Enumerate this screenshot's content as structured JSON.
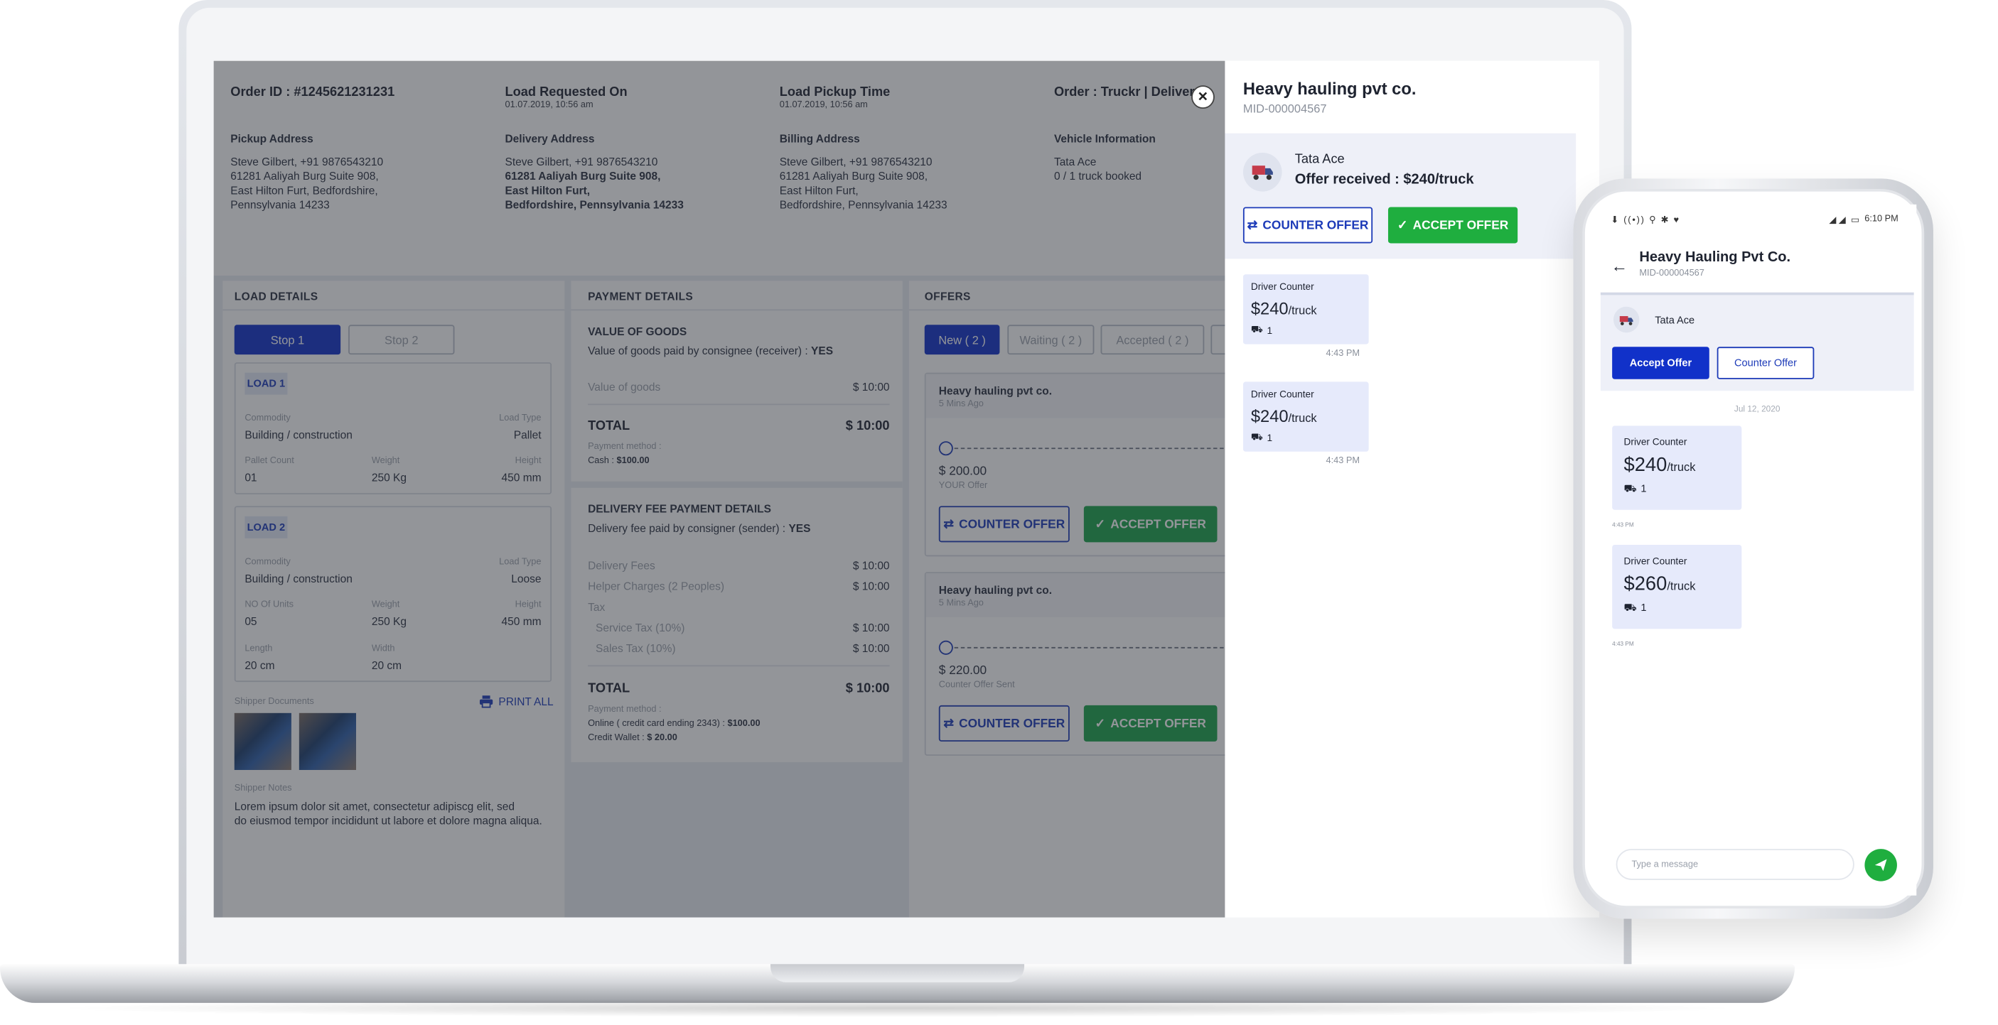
{
  "order": {
    "order_id": "Order ID : #1245621231231",
    "requested_label": "Load Requested On",
    "requested_value": "01.07.2019, 10:56 am",
    "pickup_time_label": "Load Pickup Time",
    "pickup_time_value": "01.07.2019, 10:56 am",
    "order_type": "Order : Truckr | Delivery",
    "pickup_address_label": "Pickup Address",
    "pickup_address": [
      "Steve Gilbert, +91 9876543210",
      "61281 Aaliyah Burg Suite 908,",
      "East Hilton Furt, Bedfordshire,",
      "Pennsylvania 14233"
    ],
    "delivery_address_label": "Delivery Address",
    "delivery_address": [
      "Steve Gilbert, +91 9876543210",
      "61281 Aaliyah Burg Suite 908,",
      "East Hilton Furt,",
      "Bedfordshire, Pennsylvania 14233"
    ],
    "billing_address_label": "Billing Address",
    "billing_address": [
      "Steve Gilbert, +91 9876543210",
      "61281 Aaliyah Burg Suite 908,",
      "East Hilton Furt,",
      "Bedfordshire, Pennsylvania 14233"
    ],
    "vehicle_label": "Vehicle Information",
    "vehicle": [
      "Tata Ace",
      "0 / 1 truck booked"
    ]
  },
  "load_details": {
    "title": "LOAD DETAILS",
    "stops": [
      "Stop 1",
      "Stop 2"
    ],
    "load1": {
      "tag": "LOAD 1",
      "commodity_label": "Commodity",
      "commodity": "Building / construction",
      "load_type_label": "Load Type",
      "load_type": "Pallet",
      "pallet_label": "Pallet Count",
      "pallet": "01",
      "weight_label": "Weight",
      "weight": "250 Kg",
      "height_label": "Height",
      "height": "450 mm"
    },
    "load2": {
      "tag": "LOAD 2",
      "commodity_label": "Commodity",
      "commodity": "Building / construction",
      "load_type_label": "Load Type",
      "load_type": "Loose",
      "units_label": "NO Of Units",
      "units": "05",
      "weight_label": "Weight",
      "weight": "250 Kg",
      "height_label": "Height",
      "height": "450 mm",
      "length_label": "Length",
      "length": "20 cm",
      "width_label": "Width",
      "width": "20 cm"
    },
    "docs_label": "Shipper Documents",
    "print_all": "PRINT ALL",
    "notes_label": "Shipper Notes",
    "notes": [
      "Lorem ipsum dolor sit amet, consectetur adipiscg  elit, sed",
      "do eiusmod tempor incididunt ut labore et dolore magna aliqua."
    ]
  },
  "payment": {
    "title": "PAYMENT DETAILS",
    "goods_title": "VALUE OF GOODS",
    "goods_paid_by": "Value of goods paid by consignee (receiver) :",
    "goods_paid_yes": "YES",
    "goods_value_label": "Value of goods",
    "goods_value": "$ 10:00",
    "total_label": "TOTAL",
    "total": "$ 10:00",
    "method_label": "Payment method :",
    "goods_method": "Cash :",
    "goods_method_value": "$100.00",
    "delivery_title": "DELIVERY FEE PAYMENT DETAILS",
    "delivery_paid_by": "Delivery fee paid by consigner (sender) :",
    "delivery_paid_yes": "YES",
    "fees": [
      {
        "label": "Delivery Fees",
        "value": "$ 10:00"
      },
      {
        "label": "Helper Charges (2 Peoples)",
        "value": "$ 10:00"
      }
    ],
    "tax_label": "Tax",
    "taxes": [
      {
        "label": "Service Tax (10%)",
        "value": "$ 10:00"
      },
      {
        "label": "Sales Tax (10%)",
        "value": "$ 10:00"
      }
    ],
    "total2": "$ 10:00",
    "online_label": "Online ( credit card ending 2343) :",
    "online_value": "$100.00",
    "wallet_label": "Credit Wallet :",
    "wallet_value": "$ 20.00"
  },
  "offers": {
    "title": "OFFERS",
    "tabs": [
      "New ( 2 )",
      "Waiting ( 2 )",
      "Accepted ( 2 )"
    ],
    "cards": [
      {
        "company": "Heavy hauling pvt co.",
        "time": "5 Mins Ago",
        "amount": "$ 200.00",
        "note": "YOUR Offer"
      },
      {
        "company": "Heavy hauling pvt co.",
        "time": "5 Mins Ago",
        "amount": "$ 220.00",
        "note": "Counter Offer Sent"
      }
    ],
    "counter_label": "COUNTER OFFER",
    "accept_label": "ACCEPT OFFER"
  },
  "side_panel": {
    "company": "Heavy hauling pvt co.",
    "mid": "MID-000004567",
    "vehicle": "Tata Ace",
    "offer_received": "Offer received : $240/truck",
    "counter_label": "COUNTER OFFER",
    "accept_label": "ACCEPT OFFER",
    "messages": [
      {
        "title": "Driver Counter",
        "amount": "$240",
        "unit": "/truck",
        "count": "1",
        "time": "4:43 PM"
      },
      {
        "title": "Driver Counter",
        "amount": "$240",
        "unit": "/truck",
        "count": "1",
        "time": "4:43 PM"
      }
    ]
  },
  "phone": {
    "status_time": "6:10 PM",
    "company": "Heavy Hauling Pvt Co.",
    "mid": "MID-000004567",
    "vehicle": "Tata Ace",
    "accept_label": "Accept Offer",
    "counter_label": "Counter Offer",
    "date": "Jul 12, 2020",
    "messages": [
      {
        "title": "Driver Counter",
        "amount": "$240",
        "unit": "/truck",
        "count": "1",
        "time": "4:43 PM"
      },
      {
        "title": "Driver Counter",
        "amount": "$260",
        "unit": "/truck",
        "count": "1",
        "time": "4:43 PM"
      }
    ],
    "input_placeholder": "Type a message"
  },
  "colors": {
    "primary": "#1131c9",
    "accept": "#1aa34a",
    "bubble": "#e6eafb"
  }
}
